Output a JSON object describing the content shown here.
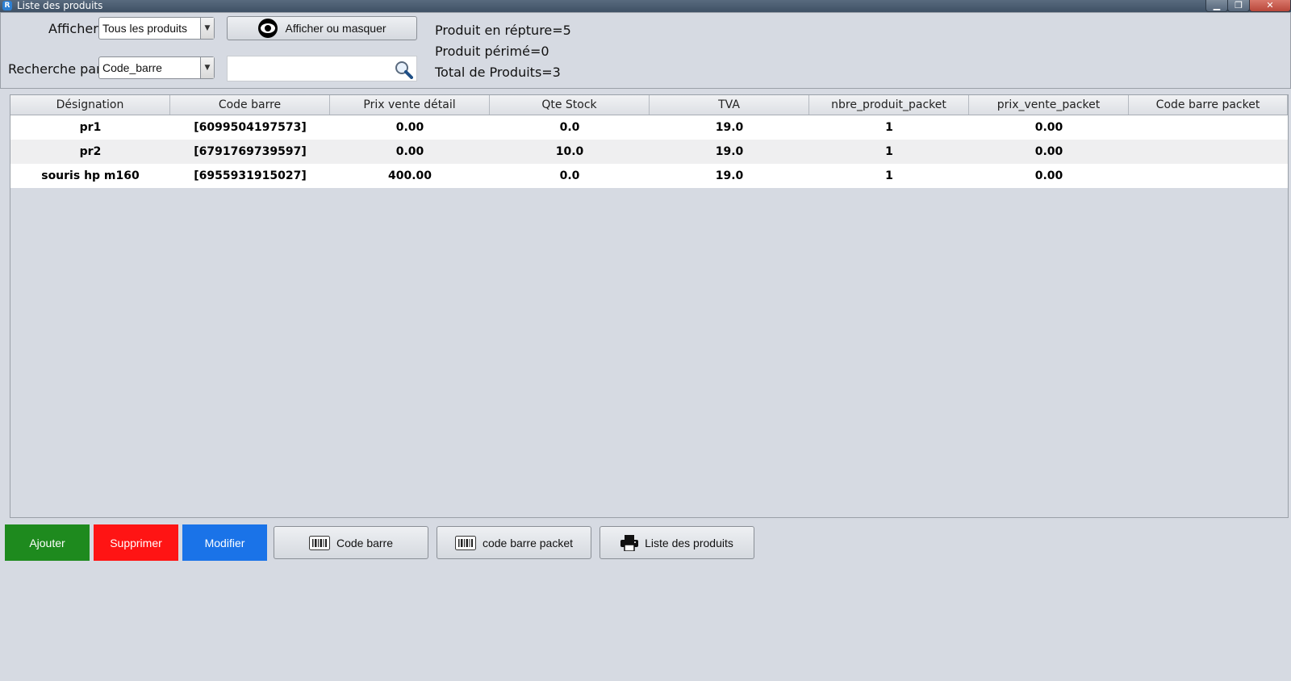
{
  "window": {
    "title": "Liste des produits",
    "app_icon": "R",
    "controls": {
      "minimize": "▁",
      "maximize": "❐",
      "close": "✕"
    }
  },
  "toolbar": {
    "show_label": "Afficher",
    "show_value": "Tous les produits",
    "toggle_button": "Afficher ou masquer",
    "search_by_label": "Recherche par",
    "search_by_value": "Code_barre",
    "search_value": "",
    "icons": {
      "toggle": "eye-icon",
      "search": "magnifier-icon"
    }
  },
  "stats": {
    "out_of_stock": "Produit en répture=5",
    "expired": "Produit périmé=0",
    "total": "Total  de Produits=3"
  },
  "table": {
    "columns": [
      "Désignation",
      "Code barre",
      "Prix vente détail",
      "Qte Stock",
      "TVA",
      "nbre_produit_packet",
      "prix_vente_packet",
      "Code barre packet"
    ],
    "rows": [
      [
        "pr1",
        "[6099504197573]",
        "0.00",
        "0.0",
        "19.0",
        "1",
        "0.00",
        ""
      ],
      [
        "pr2",
        "[6791769739597]",
        "0.00",
        "10.0",
        "19.0",
        "1",
        "0.00",
        ""
      ],
      [
        "souris hp m160",
        "[6955931915027]",
        "400.00",
        "0.0",
        "19.0",
        "1",
        "0.00",
        ""
      ]
    ]
  },
  "actions": {
    "add": "Ajouter",
    "delete": "Supprimer",
    "edit": "Modifier",
    "barcode": "Code barre",
    "barcode_packet": "code barre packet",
    "print_list": "Liste des produits",
    "icons": {
      "barcode": "barcode-icon",
      "print": "printer-icon"
    }
  },
  "colors": {
    "add": "#1e8a1e",
    "delete": "#ff1414",
    "edit": "#1a73e8",
    "background": "#d6dae2"
  }
}
